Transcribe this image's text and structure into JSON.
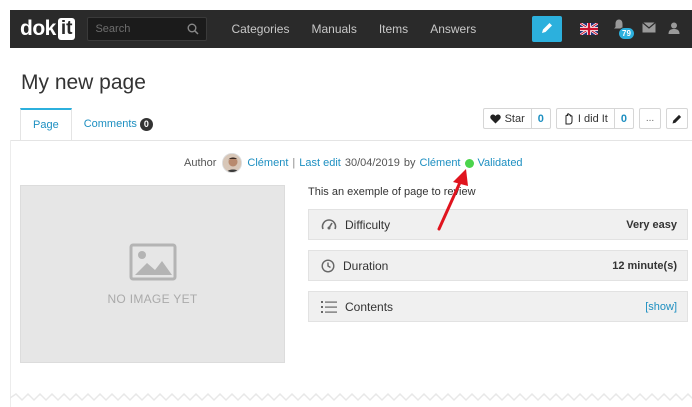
{
  "nav": {
    "logo_text": "dok",
    "logo_box": "it",
    "search_placeholder": "Search",
    "menu": [
      "Categories",
      "Manuals",
      "Items",
      "Answers"
    ],
    "notifications_count": "79",
    "icons": [
      "pencil-icon",
      "uk-flag-icon",
      "bell-icon",
      "mail-icon",
      "user-icon"
    ]
  },
  "page": {
    "title": "My new page",
    "tabs": [
      {
        "label": "Page",
        "active": true
      },
      {
        "label": "Comments",
        "count": "0"
      }
    ],
    "actions": {
      "star_label": "Star",
      "star_count": "0",
      "didit_label": "I did It",
      "didit_count": "0",
      "more_label": "..."
    },
    "meta": {
      "author_label": "Author",
      "author_name": "Clément",
      "last_edit_label": "Last edit",
      "last_edit_date": "30/04/2019",
      "by_label": "by",
      "editor_name": "Clément",
      "status": "Validated",
      "status_color": "#4cd44c"
    },
    "image_placeholder": "NO IMAGE YET",
    "description": "This an exemple of page to review",
    "info": [
      {
        "icon": "gauge-icon",
        "label": "Difficulty",
        "value": "Very easy"
      },
      {
        "icon": "clock-icon",
        "label": "Duration",
        "value": "12 minute(s)"
      },
      {
        "icon": "list-icon",
        "label": "Contents",
        "value": "[show]"
      }
    ]
  },
  "colors": {
    "accent": "#2cb0dd",
    "navbar": "#2a2a2a",
    "link": "#1d8fc1",
    "annotation_arrow": "#e0141e"
  }
}
